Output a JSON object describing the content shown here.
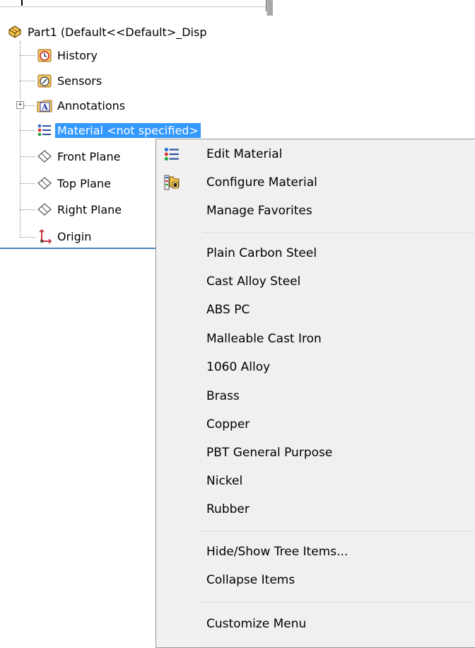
{
  "tree": {
    "root": {
      "label": "Part1  (Default<<Default>_Disp",
      "icon": "part-icon"
    },
    "items": [
      {
        "label": "History",
        "icon": "history-icon"
      },
      {
        "label": "Sensors",
        "icon": "sensors-icon"
      },
      {
        "label": "Annotations",
        "icon": "annotations-icon",
        "expander": "+"
      },
      {
        "label": "Material <not specified>",
        "icon": "material-icon",
        "selected": true
      },
      {
        "label": "Front Plane",
        "icon": "plane-icon"
      },
      {
        "label": "Top Plane",
        "icon": "plane-icon"
      },
      {
        "label": "Right Plane",
        "icon": "plane-icon"
      },
      {
        "label": "Origin",
        "icon": "origin-icon"
      }
    ]
  },
  "menu": {
    "group1": [
      {
        "label": "Edit Material",
        "icon": "material-icon"
      },
      {
        "label": "Configure Material",
        "icon": "configure-material-icon"
      },
      {
        "label": "Manage Favorites",
        "icon": ""
      }
    ],
    "favorites": [
      {
        "label": "Plain Carbon Steel"
      },
      {
        "label": "Cast Alloy Steel"
      },
      {
        "label": "ABS PC"
      },
      {
        "label": "Malleable Cast Iron"
      },
      {
        "label": "1060 Alloy"
      },
      {
        "label": "Brass"
      },
      {
        "label": "Copper"
      },
      {
        "label": "PBT General Purpose"
      },
      {
        "label": "Nickel"
      },
      {
        "label": "Rubber"
      }
    ],
    "group3": [
      {
        "label": "Hide/Show Tree Items..."
      },
      {
        "label": "Collapse Items"
      }
    ],
    "group4": [
      {
        "label": "Customize Menu"
      }
    ]
  },
  "colors": {
    "selection": "#3399ff",
    "panel_border": "#4a7fc0",
    "menu_background": "#f0f0f0"
  }
}
